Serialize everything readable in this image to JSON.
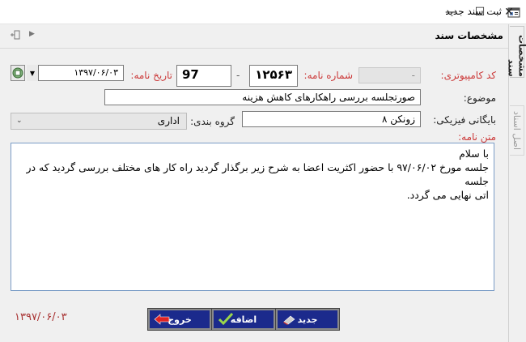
{
  "window": {
    "title": "ثبت سند جدید",
    "controls": {
      "minimize": "—",
      "maximize": "☐",
      "close": "✕"
    }
  },
  "tabs": {
    "active": "مشخصات سند",
    "inactive": "اصل اسناد"
  },
  "header": {
    "title": "مشخصات سند"
  },
  "form": {
    "computer_code_label": "کد کامپیوتری:",
    "computer_code_value": "-",
    "letter_number_label": "شماره نامه:",
    "letter_number_value": "۱۲۵۶۳",
    "separator": "-",
    "letter_suffix_value": "97",
    "letter_date_label": "تاریخ نامه:",
    "letter_date_value": "۱۳۹۷/۰۶/۰۳",
    "subject_label": "موضوع:",
    "subject_value": "صورتجلسه بررسی راهکارهای کاهش هزینه",
    "archive_label": "بایگانی فیزیکی:",
    "archive_value": "زونکن ۸",
    "group_label": "گروه بندی:",
    "group_value": "اداری",
    "body_label": "متن نامه:",
    "body_lines": [
      "با سلام",
      "جلسه مورخ ۹۷/۰۶/۰۲ با حضور اکثریت اعضا به شرح زیر برگذار گردید راه کار های مختلف بررسی گردید که در جلسه",
      "اتی نهایی می گردد."
    ]
  },
  "footer": {
    "date": "۱۳۹۷/۰۶/۰۳",
    "new_label": "جدید",
    "add_label": "اضافه",
    "exit_label": "خروج"
  },
  "colors": {
    "label_red": "#cc3a3a",
    "button_bg": "#1b2a8c",
    "footer_date": "#a83232"
  }
}
